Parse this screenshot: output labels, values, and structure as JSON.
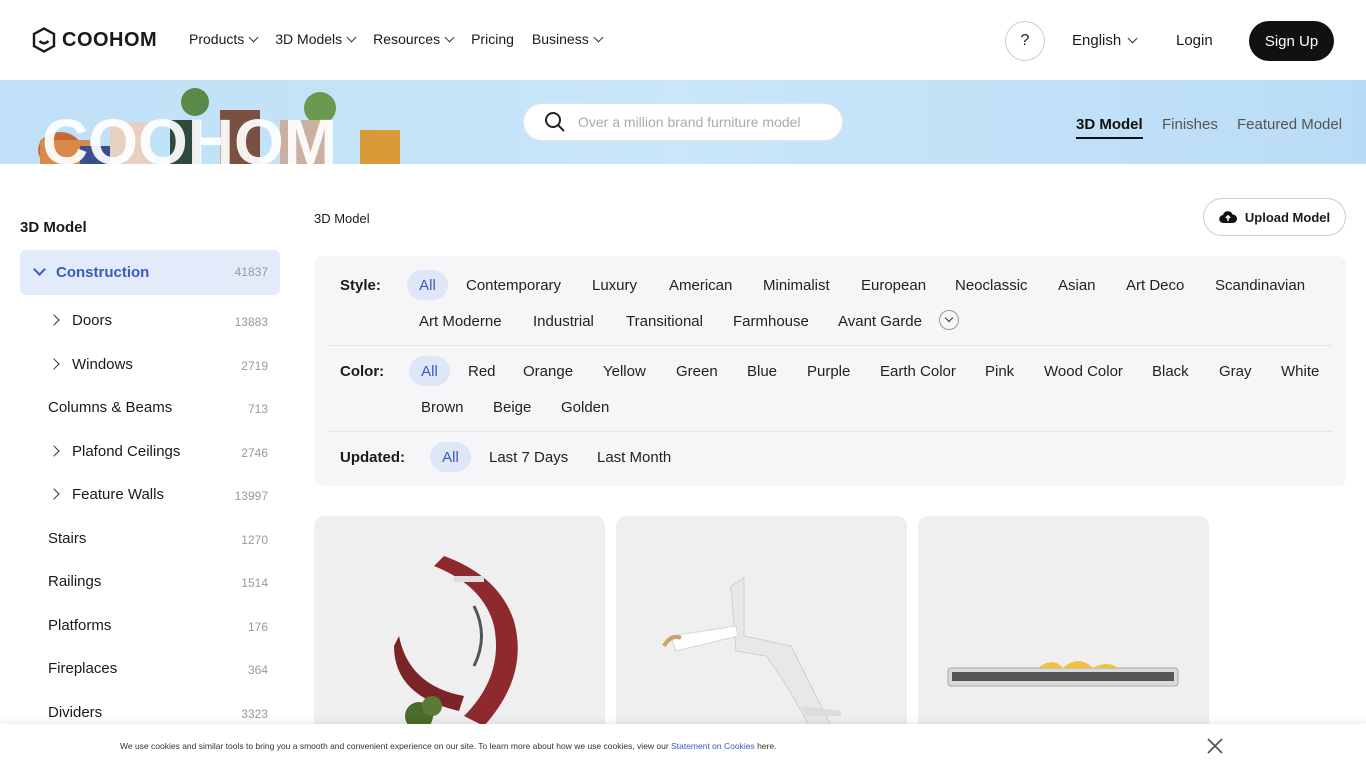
{
  "header": {
    "brand": "COOHOM",
    "nav": [
      "Products",
      "3D Models",
      "Resources",
      "Pricing",
      "Business"
    ],
    "help": "?",
    "language": "English",
    "login": "Login",
    "signup": "Sign Up"
  },
  "banner": {
    "search_placeholder": "Over a million brand furniture model",
    "tabs": [
      "3D Model",
      "Finishes",
      "Featured Model"
    ]
  },
  "sidebar": {
    "title": "3D Model",
    "active": {
      "label": "Construction",
      "count": "41837"
    },
    "items": [
      {
        "label": "Doors",
        "count": "13883"
      },
      {
        "label": "Windows",
        "count": "2719"
      },
      {
        "label": "Columns & Beams",
        "count": "713"
      },
      {
        "label": "Plafond Ceilings",
        "count": "2746"
      },
      {
        "label": "Feature Walls",
        "count": "13997"
      },
      {
        "label": "Stairs",
        "count": "1270"
      },
      {
        "label": "Railings",
        "count": "1514"
      },
      {
        "label": "Platforms",
        "count": "176"
      },
      {
        "label": "Fireplaces",
        "count": "364"
      },
      {
        "label": "Dividers",
        "count": "3323"
      }
    ]
  },
  "main": {
    "breadcrumb": "3D Model",
    "upload": "Upload Model",
    "style_label": "Style:",
    "styles": [
      "All",
      "Contemporary",
      "Luxury",
      "American",
      "Minimalist",
      "European",
      "Neoclassic",
      "Asian",
      "Art Deco",
      "Scandinavian",
      "Art Moderne",
      "Industrial",
      "Transitional",
      "Farmhouse",
      "Avant Garde"
    ],
    "color_label": "Color:",
    "colors": [
      "All",
      "Red",
      "Orange",
      "Yellow",
      "Green",
      "Blue",
      "Purple",
      "Earth Color",
      "Pink",
      "Wood Color",
      "Black",
      "Gray",
      "White",
      "Brown",
      "Beige",
      "Golden"
    ],
    "updated_label": "Updated:",
    "updated": [
      "All",
      "Last 7 Days",
      "Last Month"
    ]
  },
  "cookie": {
    "text_before": "We use cookies and similar tools to bring you a smooth and convenient experience on our site. To learn more about how we use cookies, view our ",
    "link": "Statement on Cookies",
    "text_after": " here."
  },
  "colors": {
    "accent": "#3a5ac0",
    "active_bg": "#dfe6f7",
    "banner": "#c9e6fa"
  }
}
